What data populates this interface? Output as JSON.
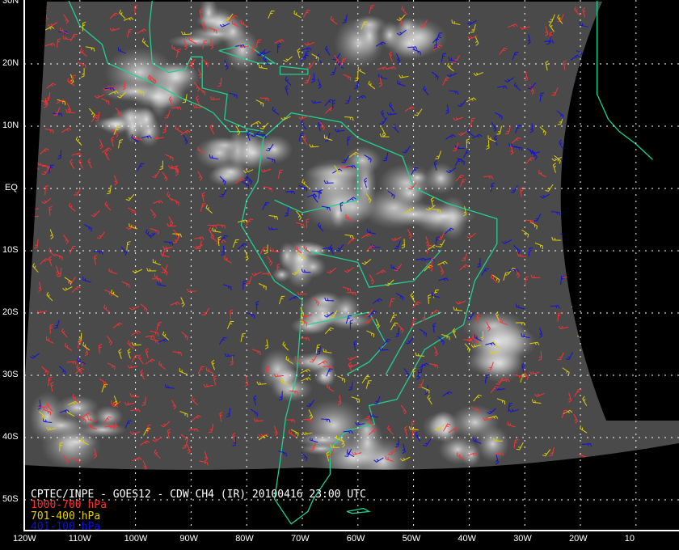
{
  "title": "CPTEC/INPE - GOES12 - CDW CH4 (IR) 20100416 23:00 UTC",
  "legend": [
    {
      "label": "1000-700 hPa",
      "color": "#ff3030"
    },
    {
      "label": "701-400 hPa",
      "color": "#e0d000"
    },
    {
      "label": "401-100 hPa",
      "color": "#1010e0"
    }
  ],
  "lat_labels": [
    "30N",
    "20N",
    "10N",
    "EQ",
    "10S",
    "20S",
    "30S",
    "40S",
    "50S"
  ],
  "lon_labels": [
    "120W",
    "110W",
    "100W",
    "90W",
    "80W",
    "70W",
    "60W",
    "50W",
    "40W",
    "30W",
    "20W",
    "10"
  ],
  "colors": {
    "coastline": "#20d090",
    "grid": "#ffffff",
    "background": "#000000"
  }
}
